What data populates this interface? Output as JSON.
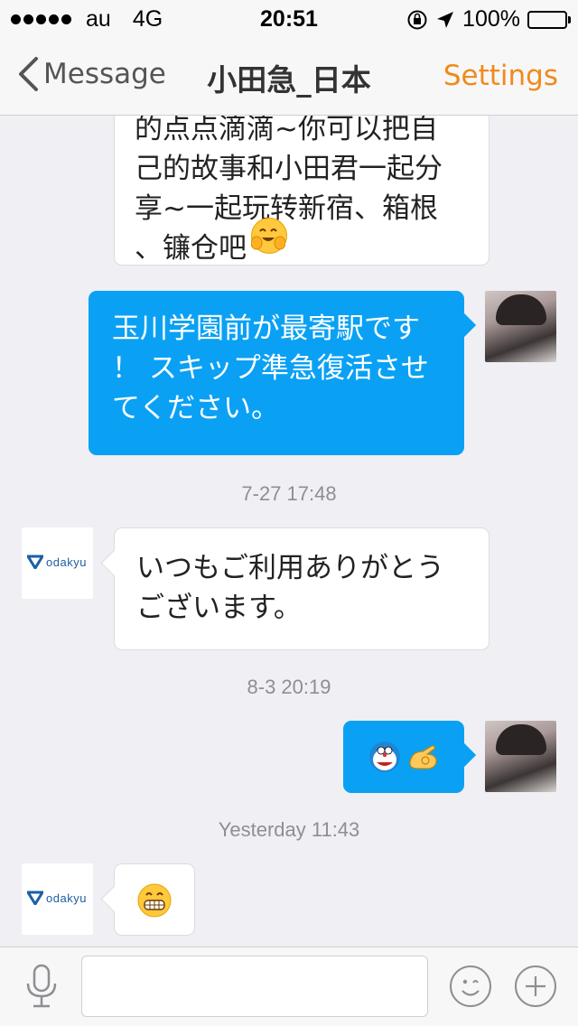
{
  "status_bar": {
    "carrier": "au",
    "network": "4G",
    "time": "20:51",
    "battery": "100%"
  },
  "nav": {
    "back_label": "Message",
    "title": "小田急_日本",
    "settings_label": "Settings",
    "accent_color": "#f08a1c"
  },
  "messages": [
    {
      "sender": "odakyu",
      "text": "的点点滴滴~你可以把自\n己的故事和小田君一起分\n享~一起玩转新宿、箱根\n、镰仓吧",
      "emoji": "hugging-face"
    },
    {
      "sender": "user",
      "text": "玉川学園前が最寄駅です\n！ スキップ準急復活させ\nてください。"
    },
    {
      "type": "timestamp",
      "text": "7-27 17:48"
    },
    {
      "sender": "odakyu",
      "text": "いつもご利用ありがとう\nございます。"
    },
    {
      "type": "timestamp",
      "text": "8-3 20:19"
    },
    {
      "sender": "user",
      "emoji": [
        "doraemon",
        "ok-hand"
      ]
    },
    {
      "type": "timestamp",
      "text": "Yesterday 11:43"
    },
    {
      "sender": "odakyu",
      "emoji": "grinning-face"
    }
  ],
  "odakyu_logo_text": "odakyu",
  "input": {
    "placeholder": ""
  },
  "colors": {
    "outgoing_bubble": "#0aa1f4",
    "incoming_bubble": "#ffffff",
    "background": "#efeff4"
  }
}
